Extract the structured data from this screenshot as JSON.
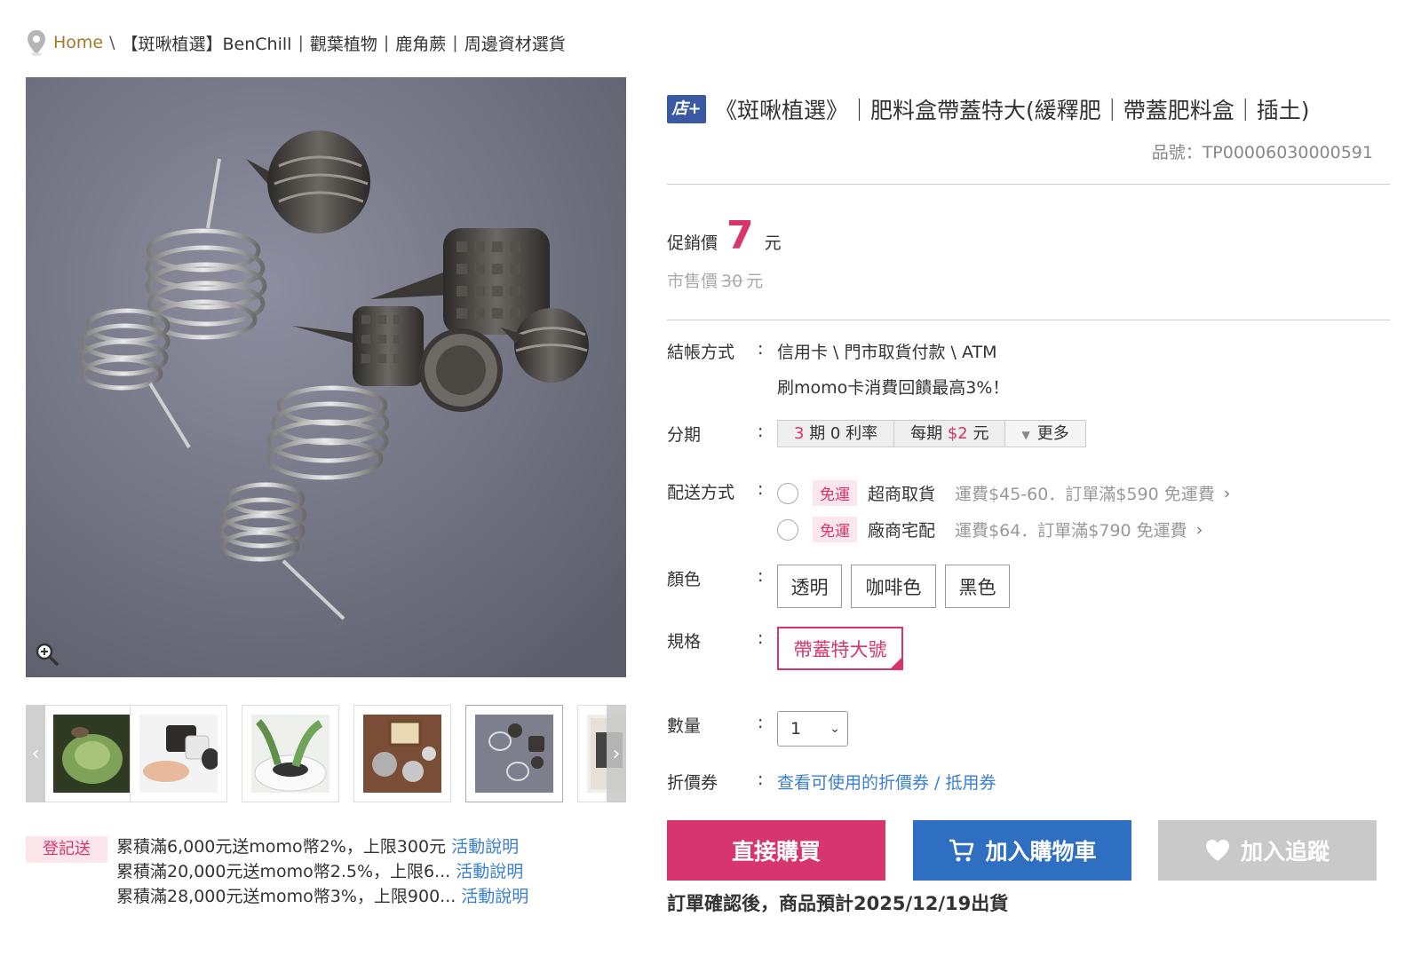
{
  "breadcrumb": {
    "home": "Home",
    "sep": "\\",
    "items": [
      "【斑啾植選】BenChill",
      "|",
      "觀葉植物",
      "|",
      "鹿角蕨",
      "|",
      "周邊資材選貨"
    ]
  },
  "product": {
    "badge": "店+",
    "title": "《斑啾植選》｜肥料盒帶蓋特大(緩釋肥｜帶蓋肥料盒｜插土)",
    "sku": "品號：TP00006030000591",
    "promo_price_label": "促銷價",
    "promo_price": "7",
    "currency": "元",
    "market_price_label": "市售價",
    "market_price": "30"
  },
  "fields": {
    "payment_label": "結帳方式",
    "payment_methods": "信用卡 \\ 門市取貨付款 \\ ATM",
    "payment_note": "刷momo卡消費回饋最高3%！",
    "installment_label": "分期",
    "installment_periods_num": "3",
    "installment_periods_text": "期 0 利率",
    "installment_per_label": "每期",
    "installment_per_amount": "$2",
    "installment_per_unit": "元",
    "installment_more": "更多",
    "shipping_label": "配送方式",
    "shipping": [
      {
        "tag": "免運",
        "name": "超商取貨",
        "fee": "運費$45-60．訂單滿$590 免運費"
      },
      {
        "tag": "免運",
        "name": "廠商宅配",
        "fee": "運費$64．訂單滿$790 免運費"
      }
    ],
    "color_label": "顏色",
    "colors": [
      "透明",
      "咖啡色",
      "黑色"
    ],
    "spec_label": "規格",
    "spec_selected": "帶蓋特大號",
    "qty_label": "數量",
    "qty_value": "1",
    "coupon_label": "折價券",
    "coupon_link": "查看可使用的折價券 / 抵用券",
    "colon": ":"
  },
  "actions": {
    "buy": "直接購買",
    "cart": "加入購物車",
    "track": "加入追蹤"
  },
  "ship_note": "訂單確認後，商品預計2025/12/19出貨",
  "promo": {
    "tag": "登記送",
    "rows": [
      {
        "text": "累積滿6,000元送momo幣2%，上限300元",
        "link": "活動說明"
      },
      {
        "text": "累積滿20,000元送momo幣2.5%，上限6...",
        "link": "活動說明"
      },
      {
        "text": "累積滿28,000元送momo幣3%，上限900...",
        "link": "活動說明"
      }
    ]
  },
  "colors": {
    "accent_pink": "#d6366d",
    "accent_blue": "#2e6fc1",
    "disabled_gray": "#c9c9c9",
    "home_gold": "#a37a2a"
  }
}
